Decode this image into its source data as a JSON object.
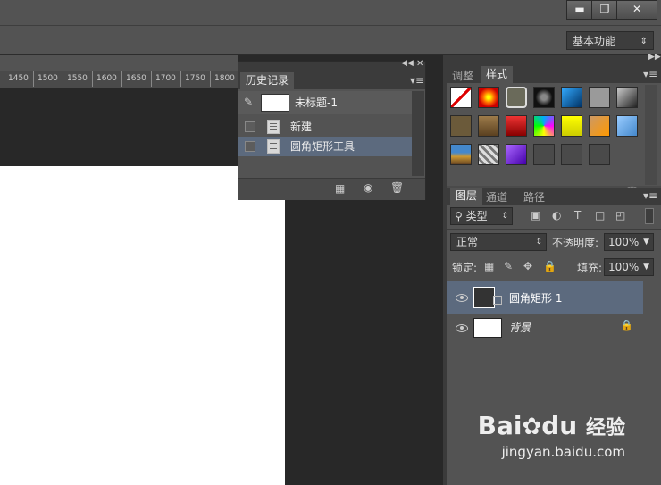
{
  "window": {
    "minimize_icon": "minimize-icon",
    "restore_icon": "restore-icon",
    "close_icon": "close-icon"
  },
  "workspace": {
    "label": "基本功能"
  },
  "ruler": {
    "ticks": [
      "1450",
      "1500",
      "1550",
      "1600",
      "1650",
      "1700",
      "1750",
      "1800"
    ]
  },
  "history": {
    "tab": "历史记录",
    "snapshot_label": "未标题-1",
    "items": [
      {
        "label": "新建",
        "selected": false
      },
      {
        "label": "圆角矩形工具",
        "selected": true
      }
    ]
  },
  "styles": {
    "tabs": [
      "调整",
      "样式"
    ],
    "active_tab": "样式"
  },
  "layers": {
    "tabs": [
      "图层",
      "通道",
      "路径"
    ],
    "filter_label": "类型",
    "blend_mode": "正常",
    "opacity_label": "不透明度:",
    "opacity_value": "100%",
    "lock_label": "锁定:",
    "fill_label": "填充:",
    "fill_value": "100%",
    "items": [
      {
        "name": "圆角矩形 1",
        "selected": true
      },
      {
        "name": "背景",
        "selected": false
      }
    ]
  },
  "colors": {
    "panel_bg": "#535353",
    "dark_bg": "#282828",
    "selection": "#5c6a7e"
  },
  "watermark": {
    "brand": "Bai",
    "brand2": "du",
    "suffix": "经验",
    "url": "jingyan.baidu.com"
  }
}
